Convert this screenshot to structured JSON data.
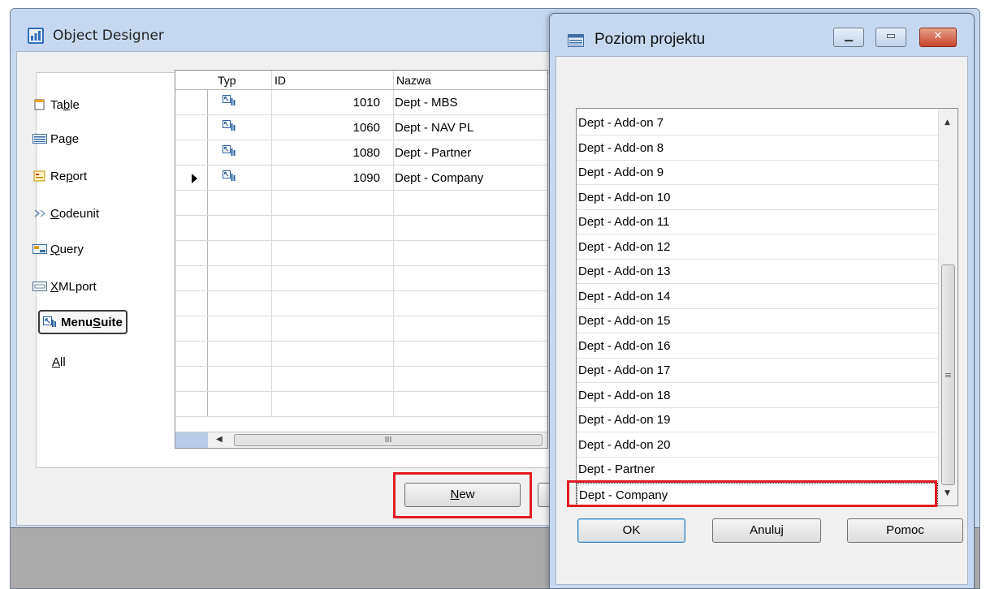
{
  "object_designer": {
    "title": "Object Designer",
    "object_types": [
      {
        "label_prefix": "Ta",
        "label_mnemonic": "b",
        "label_suffix": "le",
        "icon": "table-icon"
      },
      {
        "label_prefix": "Pa",
        "label_mnemonic": "g",
        "label_suffix": "e",
        "icon": "page-icon"
      },
      {
        "label_prefix": "Re",
        "label_mnemonic": "p",
        "label_suffix": "ort",
        "icon": "report-icon"
      },
      {
        "label_prefix": "",
        "label_mnemonic": "C",
        "label_suffix": "odeunit",
        "icon": "codeunit-icon"
      },
      {
        "label_prefix": "",
        "label_mnemonic": "Q",
        "label_suffix": "uery",
        "icon": "query-icon"
      },
      {
        "label_prefix": "",
        "label_mnemonic": "X",
        "label_suffix": "MLport",
        "icon": "xmlport-icon"
      },
      {
        "label_prefix": "Menu",
        "label_mnemonic": "S",
        "label_suffix": "uite",
        "icon": "menusuite-icon"
      },
      {
        "label_prefix": "",
        "label_mnemonic": "A",
        "label_suffix": "ll",
        "icon": ""
      }
    ],
    "selected_type": "MenuSuite",
    "grid": {
      "columns": {
        "typ": "Typ",
        "id": "ID",
        "name": "Nazwa"
      },
      "rows": [
        {
          "id": "1010",
          "name": "Dept - MBS"
        },
        {
          "id": "1060",
          "name": "Dept - NAV PL"
        },
        {
          "id": "1080",
          "name": "Dept - Partner"
        },
        {
          "id": "1090",
          "name": "Dept - Company"
        }
      ],
      "current_row": 3,
      "hscroll_grip": "III"
    },
    "new_button": {
      "prefix": "",
      "mnemonic": "N",
      "suffix": "ew"
    }
  },
  "dialog": {
    "title": "Poziom projektu",
    "items": [
      "Dept - Add-on 7",
      "Dept - Add-on 8",
      "Dept - Add-on 9",
      "Dept - Add-on 10",
      "Dept - Add-on 11",
      "Dept - Add-on 12",
      "Dept - Add-on 13",
      "Dept - Add-on 14",
      "Dept - Add-on 15",
      "Dept - Add-on 16",
      "Dept - Add-on 17",
      "Dept - Add-on 18",
      "Dept - Add-on 19",
      "Dept - Add-on 20",
      "Dept - Partner",
      "Dept - Company"
    ],
    "focused_item": "Dept - Company",
    "buttons": {
      "ok": "OK",
      "cancel": "Anuluj",
      "help": "Pomoc"
    },
    "vscroll_grip": "≡"
  },
  "colors": {
    "highlight": "#e31b23",
    "window_frame": "#c6d8ef"
  }
}
